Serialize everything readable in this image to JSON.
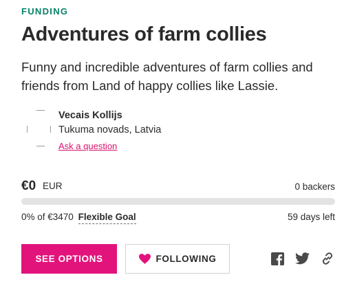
{
  "section": {
    "label": "FUNDING"
  },
  "project": {
    "title": "Adventures of farm collies",
    "description": "Funny and incredible adventures of farm collies and friends from Land of happy collies like Lassie."
  },
  "creator": {
    "name": "Vecais Kollijs",
    "location": "Tukuma novads, Latvia",
    "ask_link": "Ask a question"
  },
  "stats": {
    "amount": "€0",
    "currency": "EUR",
    "backers_count": "0",
    "backers_label": "backers",
    "percent_funded": 0,
    "funding_text": "0% of €3470",
    "goal_type": "Flexible Goal",
    "days_left": "59 days left"
  },
  "actions": {
    "see_options": "SEE OPTIONS",
    "following": "FOLLOWING"
  },
  "icons": {
    "heart": "heart-icon",
    "facebook": "facebook-icon",
    "twitter": "twitter-icon",
    "link": "link-icon"
  },
  "colors": {
    "accent": "#e2147c",
    "green": "#088366",
    "link": "#d9116f",
    "track": "#e3e3e3",
    "share_icon": "#4a4a4a"
  }
}
